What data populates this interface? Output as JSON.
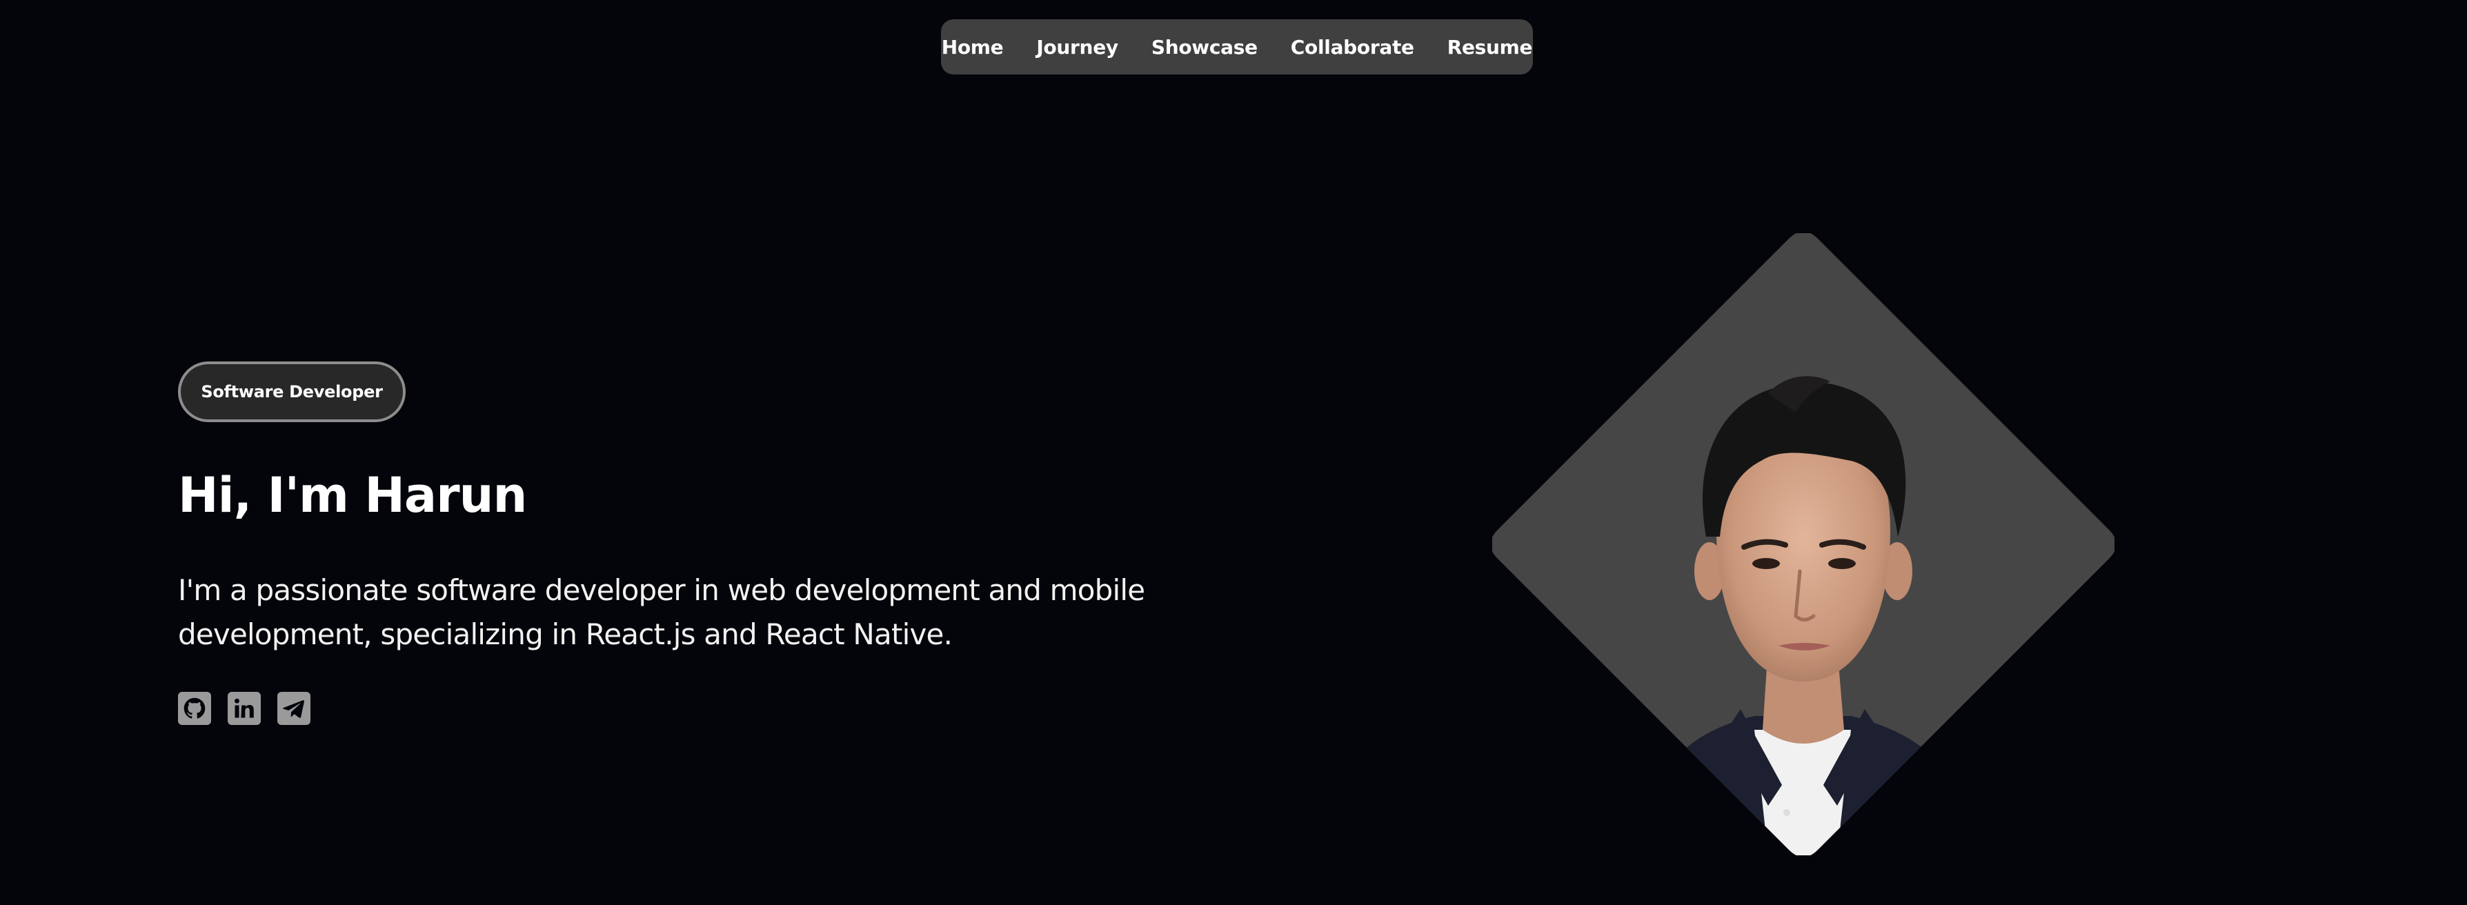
{
  "nav": {
    "items": [
      {
        "label": "Home"
      },
      {
        "label": "Journey"
      },
      {
        "label": "Showcase"
      },
      {
        "label": "Collaborate"
      },
      {
        "label": "Resume"
      }
    ]
  },
  "hero": {
    "badge": "Software Developer",
    "title": "Hi, I'm Harun",
    "description": "I'm a passionate software developer in web development and mobile development, specializing in React.js and React Native.",
    "socials": [
      {
        "icon": "github-icon"
      },
      {
        "icon": "linkedin-icon"
      },
      {
        "icon": "telegram-icon"
      }
    ]
  },
  "portrait": {
    "icon": "profile-photo"
  },
  "colors": {
    "background": "#04050a",
    "nav_background": "#404040",
    "badge_background": "#282828",
    "badge_border": "#8d8d8d",
    "social_icon": "#9a9a9a",
    "portrait_background": "#464646"
  }
}
